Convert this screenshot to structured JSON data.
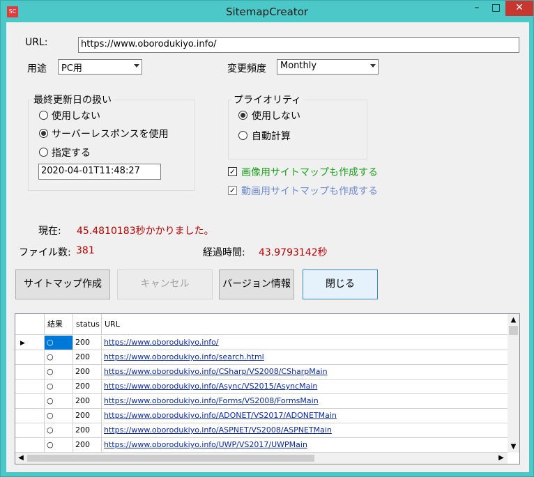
{
  "window": {
    "title": "SitemapCreator",
    "icon_text": "SC",
    "min_glyph": "–",
    "max_glyph": "□",
    "close_glyph": "✕"
  },
  "form": {
    "url_label": "URL:",
    "url_value": "https://www.oborodukiyo.info/",
    "usage_label": "用途",
    "usage_value": "PC用",
    "freq_label": "変更頻度",
    "freq_value": "Monthly"
  },
  "lastmod_group": {
    "title": "最終更新日の扱い",
    "options": [
      "使用しない",
      "サーバーレスポンスを使用",
      "指定する"
    ],
    "selected_index": 1,
    "date_value": "2020-04-01T11:48:27"
  },
  "priority_group": {
    "title": "プライオリティ",
    "options": [
      "使用しない",
      "自動計算"
    ],
    "selected_index": 0
  },
  "checkboxes": {
    "image_sitemap": {
      "label": "画像用サイトマップも作成する",
      "checked": true,
      "color": "#1ea21e"
    },
    "video_sitemap": {
      "label": "動画用サイトマップも作成する",
      "checked": true,
      "color": "#6f8ad6"
    }
  },
  "status": {
    "current_label": "現在:",
    "current_value": "45.4810183秒かかりました。",
    "files_label": "ファイル数:",
    "files_value": "381",
    "elapsed_label": "経過時間:",
    "elapsed_value": "43.9793142秒"
  },
  "buttons": {
    "create": "サイトマップ作成",
    "cancel": "キャンセル",
    "version": "バージョン情報",
    "close": "閉じる"
  },
  "grid": {
    "columns": [
      "結果",
      "status",
      "URL"
    ],
    "rows": [
      {
        "result": "○",
        "status": "200",
        "url": "https://www.oborodukiyo.info/"
      },
      {
        "result": "○",
        "status": "200",
        "url": "https://www.oborodukiyo.info/search.html"
      },
      {
        "result": "○",
        "status": "200",
        "url": "https://www.oborodukiyo.info/CSharp/VS2008/CSharpMain"
      },
      {
        "result": "○",
        "status": "200",
        "url": "https://www.oborodukiyo.info/Async/VS2015/AsyncMain"
      },
      {
        "result": "○",
        "status": "200",
        "url": "https://www.oborodukiyo.info/Forms/VS2008/FormsMain"
      },
      {
        "result": "○",
        "status": "200",
        "url": "https://www.oborodukiyo.info/ADONET/VS2017/ADONETMain"
      },
      {
        "result": "○",
        "status": "200",
        "url": "https://www.oborodukiyo.info/ASPNET/VS2008/ASPNETMain"
      },
      {
        "result": "○",
        "status": "200",
        "url": "https://www.oborodukiyo.info/UWP/VS2017/UWPMain"
      }
    ]
  },
  "colors": {
    "accent": "#4cc8c8",
    "status_red": "#c00000"
  }
}
